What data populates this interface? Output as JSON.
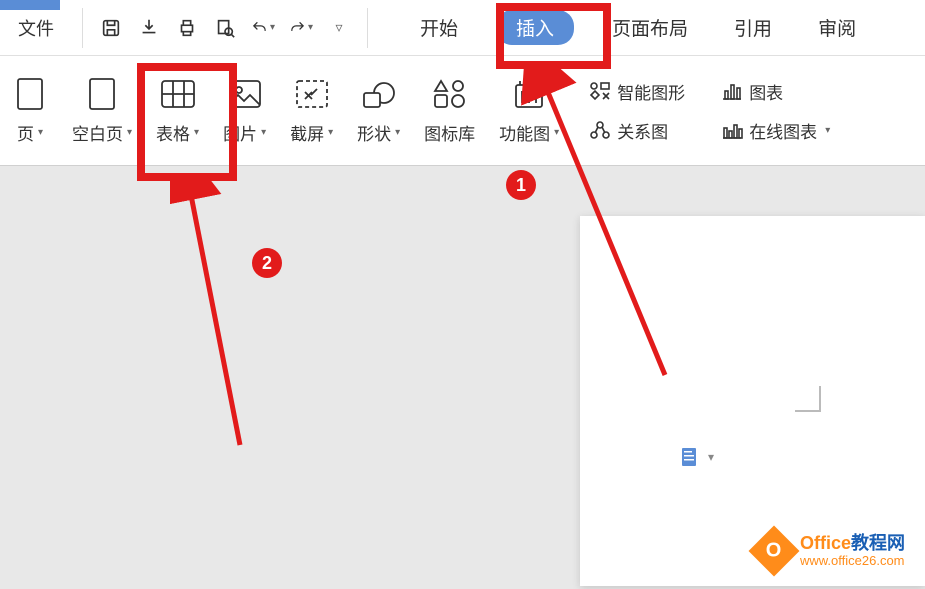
{
  "topbar": {
    "file_label": "文件"
  },
  "tabs": {
    "start": "开始",
    "insert": "插入",
    "page_layout": "页面布局",
    "references": "引用",
    "review": "审阅"
  },
  "ribbon": {
    "cover_page": "页",
    "blank_page": "空白页",
    "table": "表格",
    "picture": "图片",
    "screenshot": "截屏",
    "shapes": "形状",
    "icon_lib": "图标库",
    "function_chart": "功能图",
    "smart_art": "智能图形",
    "relation_chart": "关系图",
    "chart": "图表",
    "online_chart": "在线图表"
  },
  "annotations": {
    "badge1": "1",
    "badge2": "2"
  },
  "watermark": {
    "title_prefix": "Office",
    "title_suffix": "教程网",
    "url": "www.office26.com"
  }
}
